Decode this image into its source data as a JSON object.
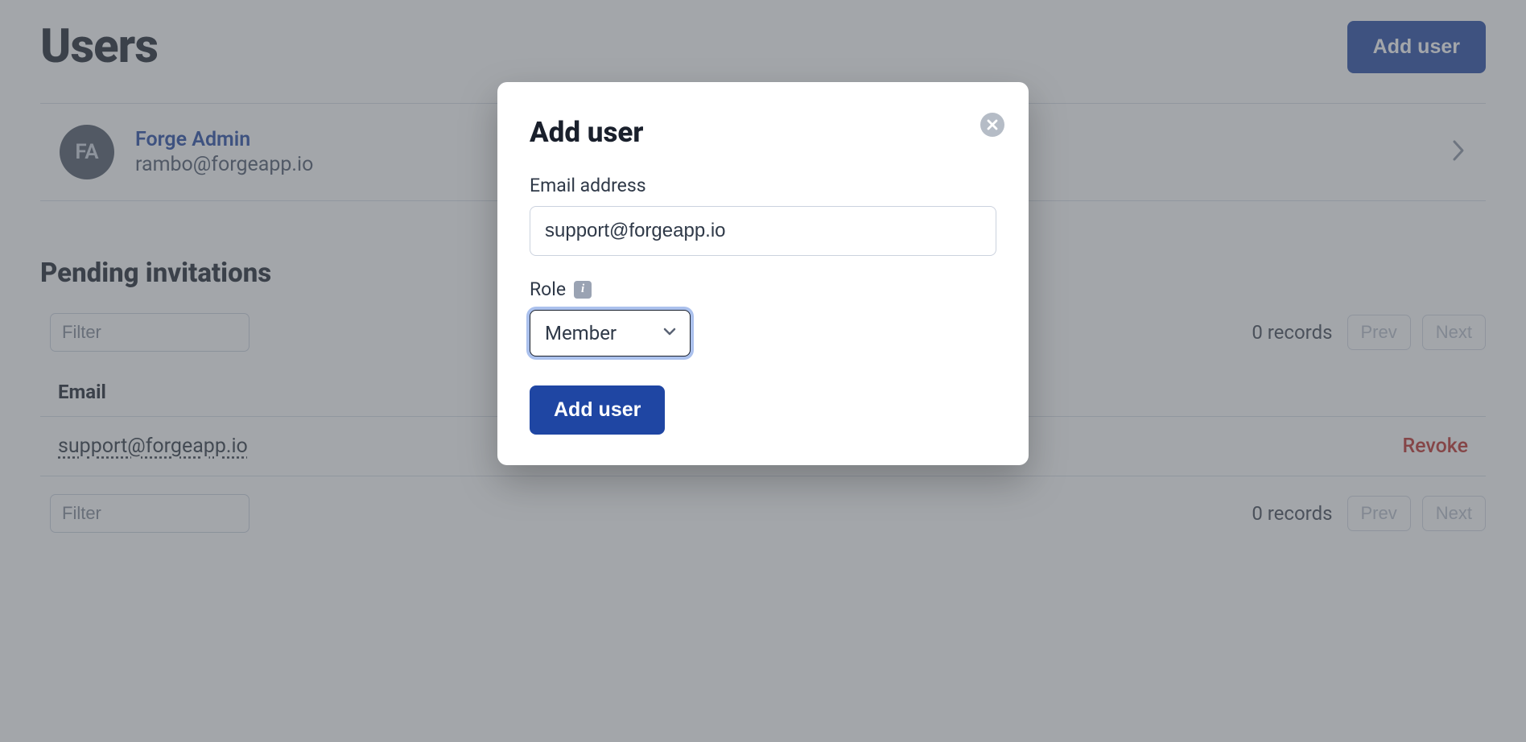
{
  "header": {
    "title": "Users",
    "add_button_label": "Add user"
  },
  "users": [
    {
      "initials": "FA",
      "name": "Forge Admin",
      "email": "rambo@forgeapp.io"
    }
  ],
  "pending": {
    "title": "Pending invitations",
    "filter_placeholder": "Filter",
    "records_text": "0 records",
    "prev_label": "Prev",
    "next_label": "Next",
    "column_header": "Email",
    "rows": [
      {
        "email": "support@forgeapp.io",
        "action_label": "Revoke"
      }
    ]
  },
  "modal": {
    "title": "Add user",
    "email_label": "Email address",
    "email_value": "support@forgeapp.io",
    "role_label": "Role",
    "role_selected": "Member",
    "submit_label": "Add user"
  }
}
